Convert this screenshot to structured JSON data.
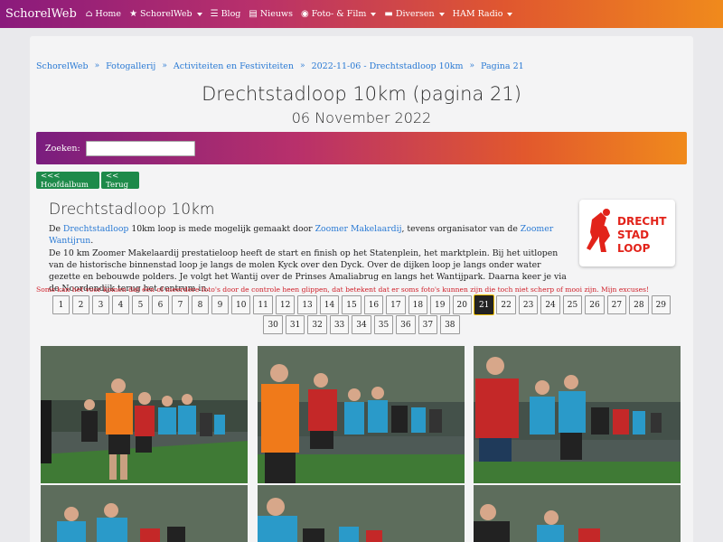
{
  "nav": {
    "brand": "SchorelWeb",
    "items": [
      {
        "label": "Home",
        "icon": "home-icon",
        "glyph": "⌂",
        "dropdown": false
      },
      {
        "label": "SchorelWeb",
        "icon": "star-icon",
        "glyph": "★",
        "dropdown": true
      },
      {
        "label": "Blog",
        "icon": "rss-icon",
        "glyph": "☰",
        "dropdown": false
      },
      {
        "label": "Nieuws",
        "icon": "newspaper-icon",
        "glyph": "▤",
        "dropdown": false
      },
      {
        "label": "Foto- & Film",
        "icon": "camera-icon",
        "glyph": "◉",
        "dropdown": true
      },
      {
        "label": "Diversen",
        "icon": "folder-icon",
        "glyph": "▬",
        "dropdown": true
      },
      {
        "label": "HAM Radio",
        "icon": "",
        "glyph": "",
        "dropdown": true
      }
    ]
  },
  "breadcrumb": [
    "SchorelWeb",
    "Fotogallerij",
    "Activiteiten en Festiviteiten",
    "2022-11-06 - Drechtstadloop 10km",
    "Pagina 21"
  ],
  "header": {
    "title": "Drechtstadloop 10km (pagina 21)",
    "date": "06 November 2022"
  },
  "search": {
    "label": "Zoeken:",
    "value": ""
  },
  "buttons": {
    "home_album": "<<< Hoofdalbum",
    "back": "<< Terug"
  },
  "album": {
    "title": "Drechtstadloop 10km",
    "p1": {
      "t1": "De ",
      "link1": "Drechtstadloop",
      "t2": " 10km loop is mede mogelijk gemaakt door ",
      "link2": "Zoomer Makelaardij",
      "t3": ", tevens organisator van de ",
      "link3": "Zoomer Wantijrun",
      "t4": "."
    },
    "p2": "De 10 km Zoomer Makelaardij prestatieloop heeft de start en finish op het Statenplein, het marktplein. Bij het uitlopen van de historische binnenstad loop je langs de molen Kyck over den Dyck. Over de dijken loop je langs onder water gezette en bebouwde polders. Je volgt het Wantij over de Prinses Amaliabrug en langs het Wantijpark. Daarna keer je via de Noordendijk terug het centrum in.",
    "logo_lines": [
      "DRECHT",
      "STAD",
      "LOOP"
    ]
  },
  "warning": "Soms kan het voor komen dat één of meerdere foto's door de controle heen glippen, dat betekent dat er soms foto's kunnen zijn die toch niet scherp of mooi zijn. Mijn excuses!",
  "pagination": {
    "row1": [
      "1",
      "2",
      "3",
      "4",
      "5",
      "6",
      "7",
      "8",
      "9",
      "10",
      "11",
      "12",
      "13",
      "14",
      "15",
      "16",
      "17",
      "18",
      "19",
      "20",
      "21",
      "22",
      "23",
      "24",
      "25",
      "26",
      "27",
      "28",
      "29"
    ],
    "row2": [
      "30",
      "31",
      "32",
      "33",
      "34",
      "35",
      "36",
      "37",
      "38"
    ],
    "current": "21"
  },
  "colors": {
    "accent_link": "#2a7ad4",
    "button_green": "#1e8a4a",
    "warning_red": "#d0202a",
    "gradient_start": "#8a1a7c",
    "gradient_end": "#f08a1c"
  }
}
